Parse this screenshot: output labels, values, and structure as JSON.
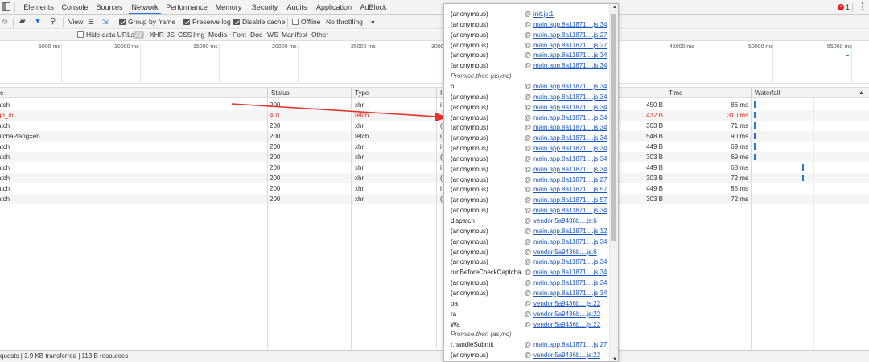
{
  "tabs": [
    "Elements",
    "Console",
    "Sources",
    "Network",
    "Performance",
    "Memory",
    "Security",
    "Audits",
    "Application",
    "AdBlock"
  ],
  "error_count": "1",
  "toolbar": {
    "view_label": "View:",
    "group_by_frame": "Group by frame",
    "preserve_log": "Preserve log",
    "disable_cache": "Disable cache",
    "offline": "Offline",
    "throttling": "No throttling"
  },
  "filter": {
    "hide_data_urls": "Hide data URLs",
    "types": [
      "All",
      "XHR",
      "JS",
      "CSS",
      "Img",
      "Media",
      "Font",
      "Doc",
      "WS",
      "Manifest",
      "Other"
    ]
  },
  "overview": {
    "ticks": [
      "5000 ms",
      "10000 ms",
      "15000 ms",
      "20000 ms",
      "25000 ms",
      "3000",
      "45000 ms",
      "50000 ms",
      "55000 ms"
    ]
  },
  "columns": {
    "name": "e",
    "status": "Status",
    "type": "Type",
    "initiator": "I",
    "time": "Time",
    "waterfall": "Waterfall"
  },
  "rows": [
    {
      "name": "atch",
      "status": "200",
      "type": "xhr",
      "init": "i",
      "size": "450 B",
      "time": "86 ms",
      "error": false
    },
    {
      "name": "gn_in",
      "status": "401",
      "type": "fetch",
      "init": "",
      "size": "432 B",
      "time": "310 ms",
      "error": true
    },
    {
      "name": "atch",
      "status": "200",
      "type": "xhr",
      "init": "(",
      "size": "303 B",
      "time": "71 ms",
      "error": false
    },
    {
      "name": "ptcha?lang=en",
      "status": "200",
      "type": "fetch",
      "init": "i",
      "size": "548 B",
      "time": "90 ms",
      "error": false
    },
    {
      "name": "atch",
      "status": "200",
      "type": "xhr",
      "init": "i",
      "size": "449 B",
      "time": "69 ms",
      "error": false
    },
    {
      "name": "atch",
      "status": "200",
      "type": "xhr",
      "init": "(",
      "size": "303 B",
      "time": "69 ms",
      "error": false
    },
    {
      "name": "atch",
      "status": "200",
      "type": "xhr",
      "init": "i",
      "size": "449 B",
      "time": "68 ms",
      "error": false
    },
    {
      "name": "atch",
      "status": "200",
      "type": "xhr",
      "init": "(",
      "size": "303 B",
      "time": "72 ms",
      "error": false
    },
    {
      "name": "atch",
      "status": "200",
      "type": "xhr",
      "init": "i",
      "size": "449 B",
      "time": "85 ms",
      "error": false
    },
    {
      "name": "atch",
      "status": "200",
      "type": "xhr",
      "init": "(",
      "size": "303 B",
      "time": "72 ms",
      "error": false
    }
  ],
  "status_bar": "quests | 3.9 KB transferred | 113 B resources",
  "call_stack": [
    {
      "fn": "(anonymous)",
      "loc": "init.js:1"
    },
    {
      "fn": "(anonymous)",
      "loc": "main.app.8a11871....js:34"
    },
    {
      "fn": "(anonymous)",
      "loc": "main.app.8a11871....js:27"
    },
    {
      "fn": "(anonymous)",
      "loc": "main.app.8a11871....js:27"
    },
    {
      "fn": "(anonymous)",
      "loc": "main.app.8a11871....js:34"
    },
    {
      "fn": "(anonymous)",
      "loc": "main.app.8a11871....js:34"
    },
    {
      "fn": "Promise.then (async)",
      "loc": "",
      "async": true
    },
    {
      "fn": "n",
      "loc": "main.app.8a11871....js:34"
    },
    {
      "fn": "(anonymous)",
      "loc": "main.app.8a11871....js:34"
    },
    {
      "fn": "(anonymous)",
      "loc": "main.app.8a11871....js:34"
    },
    {
      "fn": "(anonymous)",
      "loc": "main.app.8a11871....js:34"
    },
    {
      "fn": "(anonymous)",
      "loc": "main.app.8a11871....js:34"
    },
    {
      "fn": "(anonymous)",
      "loc": "main.app.8a11871....js:34"
    },
    {
      "fn": "(anonymous)",
      "loc": "main.app.8a11871....js:34"
    },
    {
      "fn": "(anonymous)",
      "loc": "main.app.8a11871....js:34"
    },
    {
      "fn": "(anonymous)",
      "loc": "main.app.8a11871....js:34"
    },
    {
      "fn": "(anonymous)",
      "loc": "main.app.8a11871....js:27"
    },
    {
      "fn": "(anonymous)",
      "loc": "main.app.8a11871....js:57"
    },
    {
      "fn": "(anonymous)",
      "loc": "main.app.8a11871....js:57"
    },
    {
      "fn": "(anonymous)",
      "loc": "main.app.8a11871....js:34"
    },
    {
      "fn": "dispatch",
      "loc": "vendor.5a9436b....js:6"
    },
    {
      "fn": "(anonymous)",
      "loc": "main.app.8a11871....js:12"
    },
    {
      "fn": "(anonymous)",
      "loc": "main.app.8a11871....js:34"
    },
    {
      "fn": "(anonymous)",
      "loc": "vendor.5a9436b....js:6"
    },
    {
      "fn": "(anonymous)",
      "loc": "main.app.8a11871....js:34"
    },
    {
      "fn": "runBeforeCheckCaptcha",
      "loc": "main.app.8a11871....js:34"
    },
    {
      "fn": "(anonymous)",
      "loc": "main.app.8a11871....js:34"
    },
    {
      "fn": "(anonymous)",
      "loc": "main.app.8a11871....js:34"
    },
    {
      "fn": "oa",
      "loc": "vendor.5a9436b....js:22"
    },
    {
      "fn": "ra",
      "loc": "vendor.5a9436b....js:22"
    },
    {
      "fn": "Wa",
      "loc": "vendor.5a9436b....js:22"
    },
    {
      "fn": "Promise.then (async)",
      "loc": "",
      "async": true
    },
    {
      "fn": "r.handleSubmit",
      "loc": "main.app.8a11871....js:27"
    },
    {
      "fn": "(anonymous)",
      "loc": "vendor.5a9436b....js:22"
    }
  ],
  "colors": {
    "error": "#e0291c",
    "link": "#1a56c2",
    "active_tab": "#1a73e8",
    "arrow": "#e8322a",
    "waterfall": "#1d7ad8"
  }
}
